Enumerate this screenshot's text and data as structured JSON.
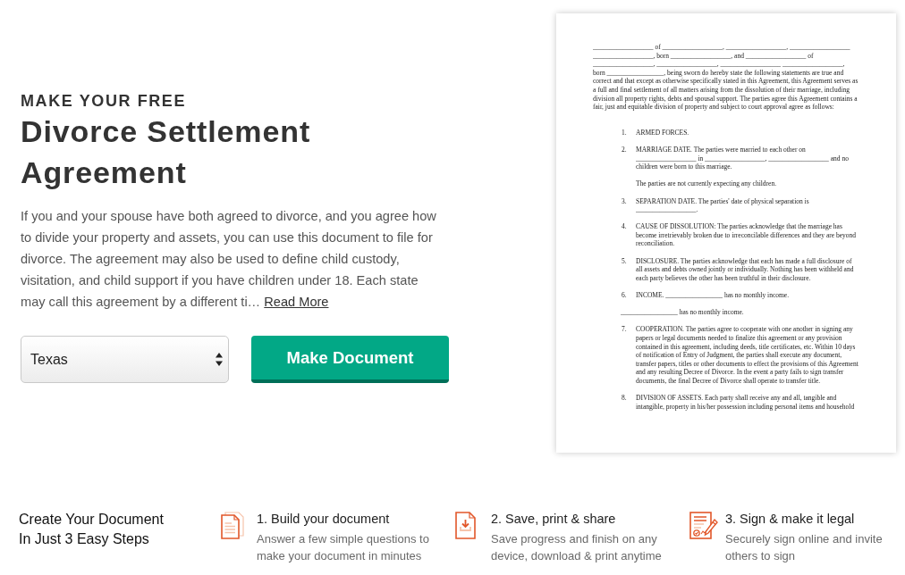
{
  "hero": {
    "eyebrow": "MAKE YOUR FREE",
    "title": "Divorce Settlement Agreement",
    "description": "If you and your spouse have both agreed to divorce, and you agree how to divide your property and assets, you can use this document to file for divorce. The agreement may also be used to define child custody, visitation, and child support if you have children under 18. Each state may call this agreement by a different ti…",
    "read_more_link": "Read More",
    "state_select": {
      "value": "Texas"
    },
    "make_button": "Make Document"
  },
  "document_preview": {
    "header_lines": [
      "__________________ of __________________, __________________, __________________",
      "__________________, born __________________, and __________________ of",
      "__________________, __________________, __________________ __________________,"
    ],
    "intro": "born _________________, being sworn do hereby state the following statements are true and correct and that except as otherwise specifically stated in this Agreement, this Agreement serves as a full and final settlement of all matters arising from the dissolution of their marriage, including division all property rights, debts and spousal support. The parties agree this Agreement contains a fair, just and equitable division of property and subject to court approval agree as follows:",
    "clauses": [
      {
        "kind": "numbered",
        "number": "1.",
        "paragraphs": [
          "ARMED FORCES."
        ]
      },
      {
        "kind": "numbered",
        "number": "2.",
        "paragraphs": [
          "MARRIAGE DATE. The parties were married to each other on __________________ in __________________, __________________ and no children were born to this marriage.",
          "The parties are not currently expecting any children."
        ]
      },
      {
        "kind": "numbered",
        "number": "3.",
        "paragraphs": [
          "SEPARATION DATE. The parties' date of physical separation is __________________."
        ]
      },
      {
        "kind": "numbered",
        "number": "4.",
        "paragraphs": [
          "CAUSE OF DISSOLUTION: The parties acknowledge that the marriage has become irretrievably broken due to irreconcilable differences and they are beyond reconciliation."
        ]
      },
      {
        "kind": "numbered",
        "number": "5.",
        "paragraphs": [
          "DISCLOSURE. The parties acknowledge that each has made a full disclosure of all assets and debts owned jointly or individually. Nothing has been withheld and each party believes the other has been truthful in their disclosure."
        ]
      },
      {
        "kind": "numbered",
        "number": "6.",
        "paragraphs": [
          "INCOME. _________________ has no monthly income."
        ]
      },
      {
        "kind": "plain",
        "paragraphs": [
          "_________________ has no monthly income."
        ]
      },
      {
        "kind": "numbered",
        "number": "7.",
        "paragraphs": [
          "COOPERATION. The parties agree to cooperate with one another in signing any papers or legal documents needed to finalize this agreement or any provision contained in this agreement, including deeds, title certificates, etc. Within 10 days of notification of Entry of Judgment, the parties shall execute any document, transfer papers, titles or other documents to effect the provisions of this Agreement and any resulting Decree of Divorce. In the event a party fails to sign transfer documents, the final Decree of Divorce shall operate to transfer title."
        ]
      },
      {
        "kind": "numbered",
        "number": "8.",
        "paragraphs": [
          "DIVISION OF ASSETS. Each party shall receive any and all, tangible and intangible, property in his/her possession including personal items and household"
        ]
      }
    ]
  },
  "steps_section": {
    "heading": "Create Your Document In Just 3 Easy Steps",
    "steps": [
      {
        "kind": "build",
        "title": "1. Build your document",
        "description": "Answer a few simple questions to make your document in minutes"
      },
      {
        "kind": "save",
        "title": "2. Save, print & share",
        "description": "Save progress and finish on any device, download & print anytime"
      },
      {
        "kind": "sign",
        "title": "3. Sign & make it legal",
        "description": "Securely sign online and invite others to sign"
      }
    ]
  }
}
